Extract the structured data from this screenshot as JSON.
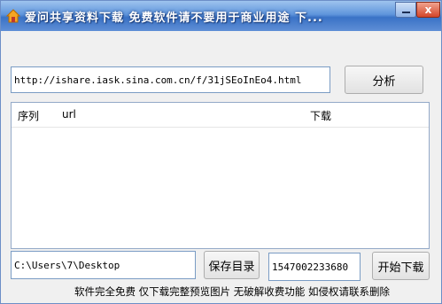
{
  "window": {
    "title": "爱问共享资料下载 免费软件请不要用于商业用途 下...",
    "minimize_glyph": "",
    "close_glyph": "x"
  },
  "toolbar": {
    "url_value": "http://ishare.iask.sina.com.cn/f/31jSEoInEo4.html",
    "analyze_label": "分析"
  },
  "list": {
    "columns": [
      "序列",
      "url",
      "下载"
    ],
    "rows": []
  },
  "bottom": {
    "save_path_value": "C:\\Users\\7\\Desktop",
    "save_dir_label": "保存目录",
    "code_value": "1547002233680",
    "start_label": "开始下载"
  },
  "footer": {
    "note": "软件完全免费 仅下载完整预览图片 无破解收费功能 如侵权请联系删除"
  },
  "colors": {
    "title_gradient_top": "#9ec3ee",
    "title_gradient_bottom": "#3a72c6",
    "close_button": "#d4462a"
  },
  "icons": [
    "house-icon",
    "minimize-icon",
    "close-icon"
  ]
}
